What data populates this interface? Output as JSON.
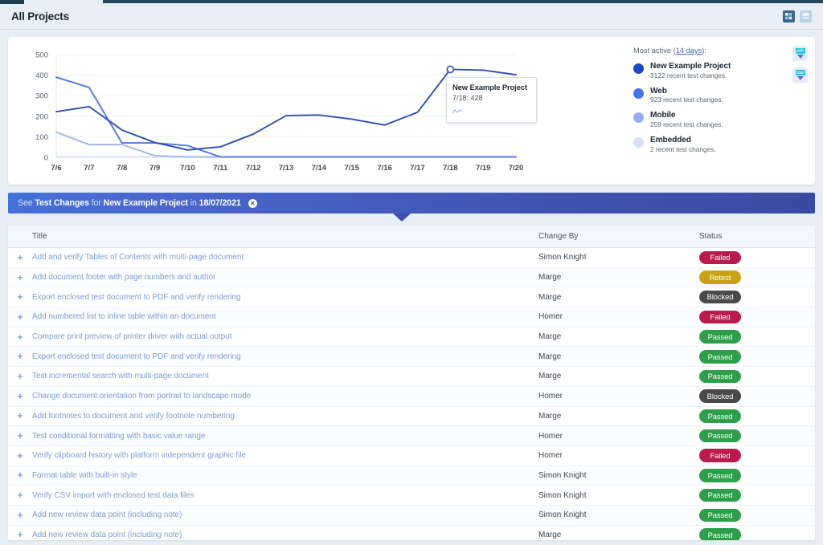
{
  "header": {
    "title": "All Projects",
    "icons": [
      {
        "name": "grid-view-icon",
        "state": "active"
      },
      {
        "name": "list-view-icon",
        "state": "inactive"
      }
    ]
  },
  "chart_card": {
    "tooltip": {
      "title": "New Example Project",
      "value": "7/18: 428",
      "mini_icon": "sparkline-icon"
    },
    "legend": {
      "heading_prefix": "Most active (",
      "heading_link": "14 days",
      "heading_suffix": "):",
      "items": [
        {
          "name": "New Example Project",
          "sub": "3122 recent test changes.",
          "color": "#1b46c4"
        },
        {
          "name": "Web",
          "sub": "923 recent test changes.",
          "color": "#4472e8"
        },
        {
          "name": "Mobile",
          "sub": "259 recent test changes.",
          "color": "#93aeee"
        },
        {
          "name": "Embedded",
          "sub": "2 recent test changes.",
          "color": "#d6e0fa"
        }
      ]
    },
    "downloads": [
      {
        "name": "download-image-button",
        "label": ""
      },
      {
        "name": "download-csv-button",
        "label": "CSV"
      }
    ]
  },
  "chart_data": {
    "type": "line",
    "title": "",
    "xlabel": "",
    "ylabel": "",
    "x": [
      "7/6",
      "7/7",
      "7/8",
      "7/9",
      "7/10",
      "7/11",
      "7/12",
      "7/13",
      "7/14",
      "7/15",
      "7/16",
      "7/17",
      "7/18",
      "7/19",
      "7/20"
    ],
    "yticks": [
      0,
      100,
      200,
      300,
      400,
      500
    ],
    "ylim": [
      0,
      500
    ],
    "grid": true,
    "legend_position": "right",
    "highlight_point": {
      "x": "7/18",
      "y": 428,
      "series": "New Example Project"
    },
    "series": [
      {
        "name": "New Example Project",
        "color": "#2f4fb8",
        "values": [
          222,
          247,
          133,
          72,
          36,
          51,
          113,
          203,
          206,
          186,
          157,
          219,
          428,
          424,
          402
        ]
      },
      {
        "name": "Web",
        "color": "#5379e0",
        "values": [
          390,
          340,
          70,
          70,
          57,
          2,
          2,
          2,
          2,
          2,
          2,
          2,
          2,
          2,
          2
        ]
      },
      {
        "name": "Mobile",
        "color": "#9db6ef",
        "values": [
          122,
          62,
          62,
          8,
          2,
          2,
          2,
          2,
          2,
          2,
          2,
          2,
          2,
          2,
          2
        ]
      },
      {
        "name": "Embedded",
        "color": "#d6e0fa",
        "values": [
          2,
          2,
          2,
          2,
          2,
          2,
          2,
          2,
          2,
          2,
          2,
          2,
          2,
          2,
          2
        ]
      }
    ]
  },
  "banner": {
    "see": "See",
    "test_changes": "Test Changes",
    "for": "for",
    "project": "New Example Project",
    "in": "in",
    "date": "18/07/2021",
    "close_icon": "close-icon"
  },
  "table": {
    "columns": [
      "Title",
      "Change By",
      "Status"
    ],
    "rows": [
      {
        "title": "Add and verify Tables of Contents with multi-page document",
        "by": "Simon Knight",
        "status": "Failed"
      },
      {
        "title": "Add document footer with page numbers and author",
        "by": "Marge",
        "status": "Retest"
      },
      {
        "title": "Export enclosed test document to PDF and verify rendering",
        "by": "Marge",
        "status": "Blocked"
      },
      {
        "title": "Add numbered list to inline table within an document",
        "by": "Homer",
        "status": "Failed"
      },
      {
        "title": "Compare print preview of printer driver with actual output",
        "by": "Marge",
        "status": "Passed"
      },
      {
        "title": "Export enclosed test document to PDF and verify rendering",
        "by": "Marge",
        "status": "Passed"
      },
      {
        "title": "Test incremental search with multi-page document",
        "by": "Marge",
        "status": "Passed"
      },
      {
        "title": "Change document orientation from portrait to landscape mode",
        "by": "Homer",
        "status": "Blocked"
      },
      {
        "title": "Add footnotes to document and verify footnote numbering",
        "by": "Marge",
        "status": "Passed"
      },
      {
        "title": "Test conditional formatting with basic value range",
        "by": "Homer",
        "status": "Passed"
      },
      {
        "title": "Verify clipboard history with platform independent graphic file",
        "by": "Homer",
        "status": "Failed"
      },
      {
        "title": "Format table with built-in style",
        "by": "Simon Knight",
        "status": "Passed"
      },
      {
        "title": "Verify CSV import with enclosed test data files",
        "by": "Simon Knight",
        "status": "Passed"
      },
      {
        "title": "Add new review data point (including note)",
        "by": "Simon Knight",
        "status": "Passed"
      },
      {
        "title": "Add new review data point (including note)",
        "by": "Marge",
        "status": "Passed"
      }
    ],
    "expand_icon": "plus-icon"
  }
}
